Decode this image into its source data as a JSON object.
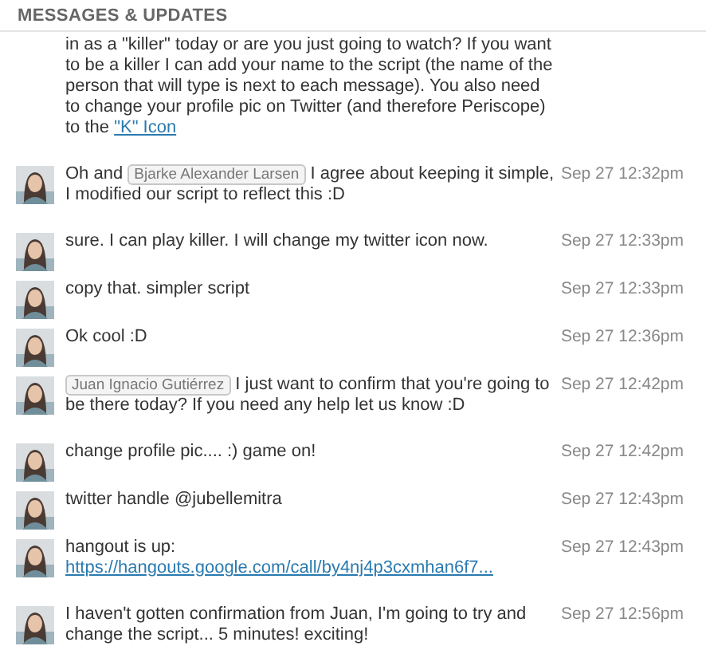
{
  "header": {
    "title": "MESSAGES & UPDATES"
  },
  "messages": [
    {
      "parts": [
        {
          "kind": "text",
          "text": "in as a \"killer\" today or are you just going to watch? If you want to be a killer I can add your name to the script (the name of the person that will type is next to each message). You also need to change your profile pic on Twitter (and therefore Periscope) to the "
        },
        {
          "kind": "link",
          "text": "\"K\" Icon"
        }
      ]
    },
    {
      "avatar": {
        "kind": "picture"
      },
      "time": "Sep 27 12:32pm",
      "parts": [
        {
          "kind": "text",
          "text": "Oh and "
        },
        {
          "kind": "mention",
          "text": "Bjarke Alexander Larsen"
        },
        {
          "kind": "text",
          "text": " I agree about keeping it simple, I modified our script to reflect this :D"
        }
      ]
    },
    {
      "avatar": {
        "kind": "picture"
      },
      "time": "Sep 27 12:33pm",
      "parts": [
        {
          "kind": "text",
          "text": "sure. I can play killer. I will change my twitter icon now."
        }
      ]
    },
    {
      "avatar": {
        "kind": "picture"
      },
      "time": "Sep 27 12:33pm",
      "parts": [
        {
          "kind": "text",
          "text": "copy that. simpler script"
        }
      ]
    },
    {
      "avatar": {
        "kind": "picture"
      },
      "time": "Sep 27 12:36pm",
      "parts": [
        {
          "kind": "text",
          "text": "Ok cool :D"
        }
      ]
    },
    {
      "avatar": {
        "kind": "picture"
      },
      "time": "Sep 27 12:42pm",
      "parts": [
        {
          "kind": "mention",
          "text": "Juan Ignacio Gutiérrez"
        },
        {
          "kind": "text",
          "text": " I just want to confirm that you're going to be there today? If you need any help let us know :D"
        }
      ]
    },
    {
      "avatar": {
        "kind": "picture"
      },
      "time": "Sep 27 12:42pm",
      "parts": [
        {
          "kind": "text",
          "text": "change profile pic.... :) game on!"
        }
      ]
    },
    {
      "avatar": {
        "kind": "picture"
      },
      "time": "Sep 27 12:43pm",
      "parts": [
        {
          "kind": "text",
          "text": "twitter handle @jubellemitra"
        }
      ]
    },
    {
      "avatar": {
        "kind": "picture"
      },
      "time": "Sep 27 12:43pm",
      "parts": [
        {
          "kind": "text",
          "text": "hangout is up: "
        },
        {
          "kind": "link",
          "text": "https://hangouts.google.com/call/by4nj4p3cxmhan6f7..."
        }
      ]
    },
    {
      "avatar": {
        "kind": "picture"
      },
      "time": "Sep 27 12:56pm",
      "parts": [
        {
          "kind": "text",
          "text": "I haven't gotten confirmation from Juan, I'm going to try and change the script... 5 minutes! exciting!"
        }
      ]
    }
  ]
}
